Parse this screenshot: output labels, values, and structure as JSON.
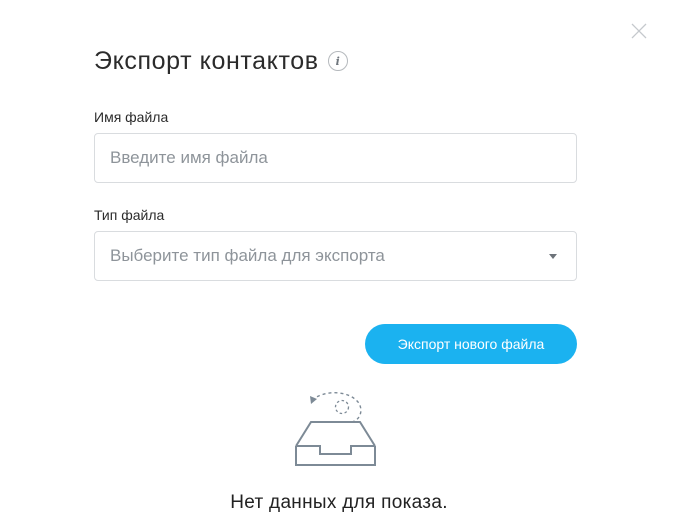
{
  "dialog": {
    "title": "Экспорт контактов",
    "info_icon": "i",
    "close_icon": "close-icon"
  },
  "form": {
    "file_name": {
      "label": "Имя файла",
      "value": "",
      "placeholder": "Введите имя файла"
    },
    "file_type": {
      "label": "Тип файла",
      "placeholder": "Выберите тип файла для экспорта"
    }
  },
  "actions": {
    "export_label": "Экспорт нового файла"
  },
  "empty_state": {
    "icon": "empty-inbox-icon",
    "message": "Нет данных для показа."
  },
  "colors": {
    "accent": "#1bb2f0",
    "border": "#d9dcdf",
    "placeholder": "#8e949a",
    "icon_gray": "#7d8a96"
  }
}
